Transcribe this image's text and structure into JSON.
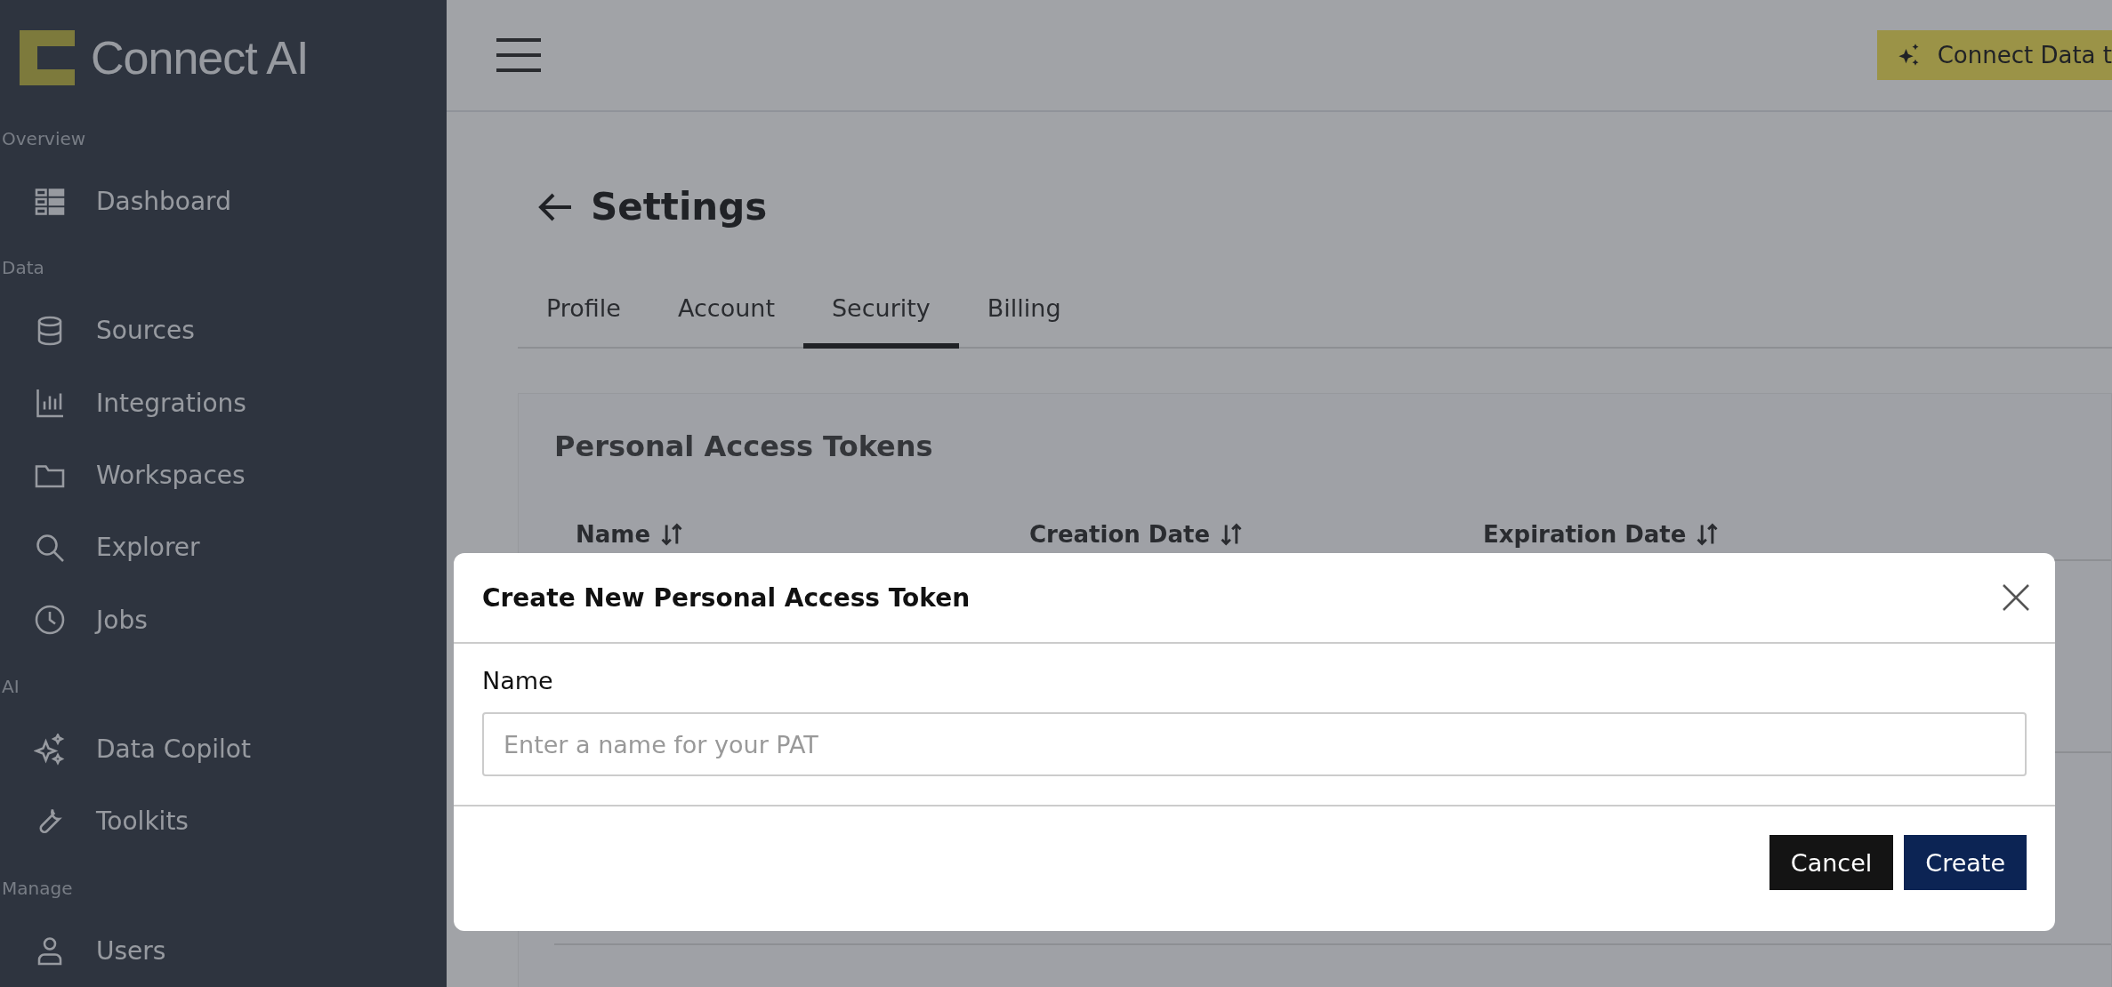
{
  "sidebar": {
    "logo": "Connect AI",
    "sections": [
      {
        "label": "Overview",
        "items": [
          {
            "label": "Dashboard"
          }
        ]
      },
      {
        "label": "Data",
        "items": [
          {
            "label": "Sources"
          },
          {
            "label": "Integrations"
          },
          {
            "label": "Workspaces"
          },
          {
            "label": "Explorer"
          },
          {
            "label": "Jobs"
          }
        ]
      },
      {
        "label": "AI",
        "items": [
          {
            "label": "Data Copilot"
          },
          {
            "label": "Toolkits"
          }
        ]
      },
      {
        "label": "Manage",
        "items": [
          {
            "label": "Users"
          }
        ]
      }
    ]
  },
  "header": {
    "cta": "Connect Data t"
  },
  "page": {
    "title": "Settings",
    "tabs": [
      {
        "label": "Profile",
        "selected": false
      },
      {
        "label": "Account",
        "selected": false
      },
      {
        "label": "Security",
        "selected": true
      },
      {
        "label": "Billing",
        "selected": false
      }
    ]
  },
  "tokens": {
    "title": "Personal Access Tokens",
    "columns": [
      "Name",
      "Creation Date",
      "Expiration Date"
    ]
  },
  "dialog": {
    "title": "Create New Personal Access Token",
    "field_label": "Name",
    "placeholder": "Enter a name for your PAT",
    "buttons": [
      {
        "label": "Cancel",
        "kind": "secondary"
      },
      {
        "label": "Create",
        "kind": "primary"
      }
    ]
  }
}
